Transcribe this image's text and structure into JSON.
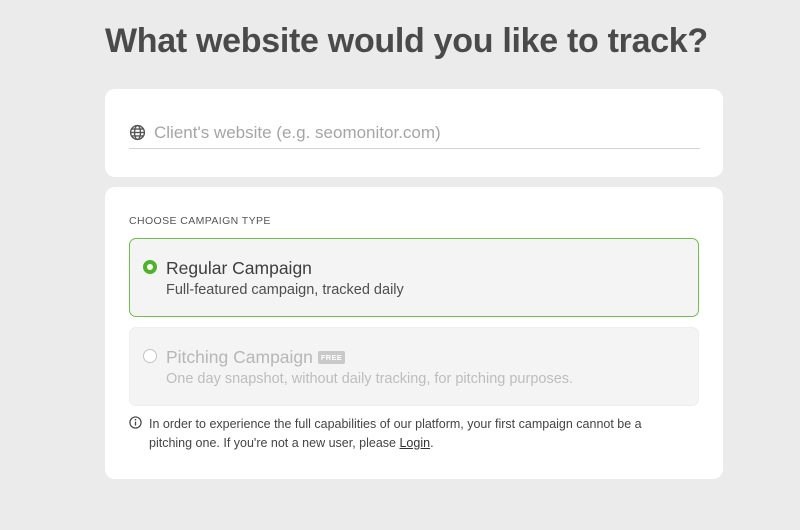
{
  "page": {
    "title": "What website would you like to track?"
  },
  "website": {
    "icon": "globe-icon",
    "placeholder": "Client's website (e.g. seomonitor.com)",
    "value": ""
  },
  "campaign": {
    "section_label": "CHOOSE CAMPAIGN TYPE",
    "options": [
      {
        "title": "Regular Campaign",
        "description": "Full-featured campaign, tracked daily",
        "selected": true,
        "disabled": false
      },
      {
        "title": "Pitching Campaign",
        "badge": "FREE",
        "description": "One day snapshot, without daily tracking, for pitching purposes.",
        "selected": false,
        "disabled": true
      }
    ],
    "note": {
      "icon": "info-icon",
      "line1": "In order to experience the full capabilities of our platform, your first campaign cannot be a",
      "line2_prefix": "pitching one. If you're not a new user, please ",
      "link_label": "Login",
      "line2_suffix": "."
    }
  },
  "colors": {
    "accent_green": "#4fb22b",
    "selected_border": "#6cc04a",
    "page_background": "#ebebeb"
  }
}
